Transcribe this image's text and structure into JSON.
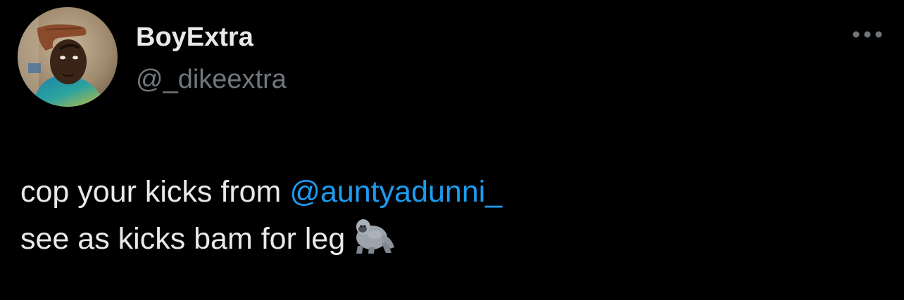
{
  "tweet": {
    "author": {
      "display_name": "BoyExtra",
      "handle": "@_dikeextra"
    },
    "text": {
      "line1_prefix": "cop your kicks from ",
      "mention": "@auntyadunni_",
      "line2": "see as kicks bam for leg",
      "emoji": "🦍"
    },
    "icons": {
      "more": "more-horizontal-icon",
      "emoji": "gorilla-icon"
    },
    "colors": {
      "background": "#000000",
      "text_primary": "#e7e9ea",
      "text_secondary": "#71767b",
      "mention": "#1d9bf0"
    }
  }
}
